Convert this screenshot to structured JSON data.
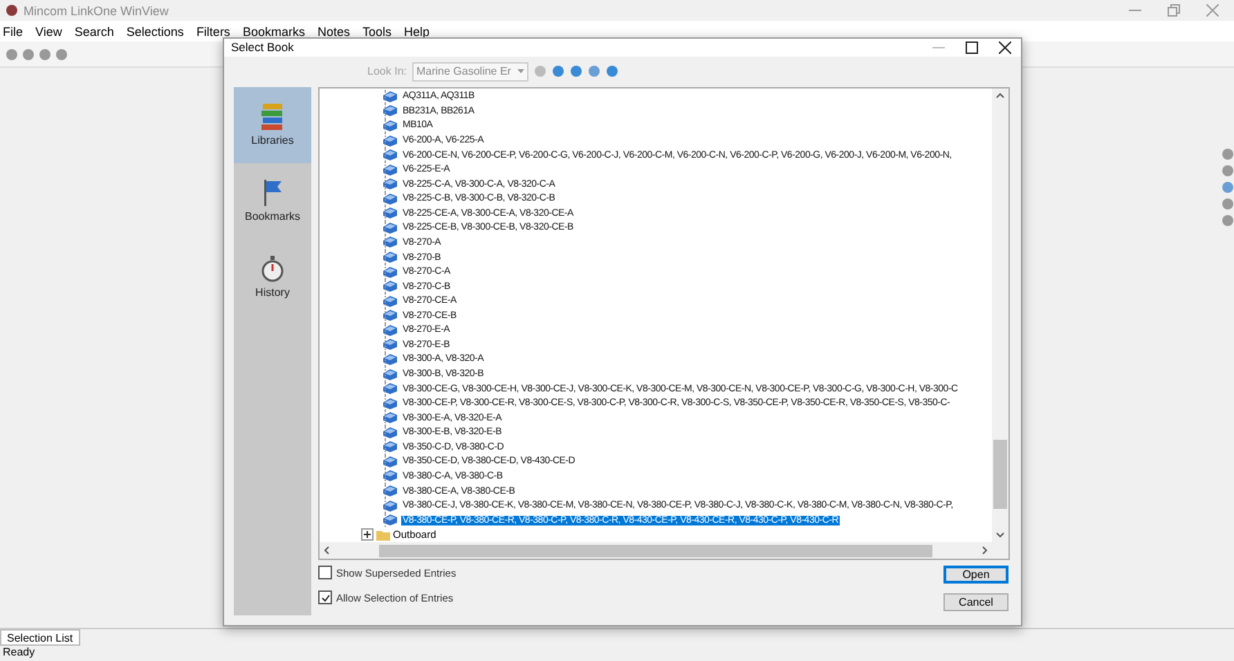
{
  "window": {
    "title": "Mincom LinkOne WinView"
  },
  "menu": [
    "File",
    "View",
    "Search",
    "Selections",
    "Filters",
    "Bookmarks",
    "Notes",
    "Tools",
    "Help"
  ],
  "dialog": {
    "title": "Select Book",
    "look_in": {
      "label": "Look In:",
      "value": "Marine Gasoline Er",
      "disabled": true
    },
    "sidebar": [
      {
        "label": "Libraries",
        "kind": "libraries",
        "selected": true
      },
      {
        "label": "Bookmarks",
        "kind": "bookmarks",
        "selected": false
      },
      {
        "label": "History",
        "kind": "history",
        "selected": false
      }
    ],
    "tree": {
      "items": [
        {
          "label": "AQ311A, AQ311B",
          "selected": false
        },
        {
          "label": "BB231A, BB261A",
          "selected": false
        },
        {
          "label": "MB10A",
          "selected": false
        },
        {
          "label": "V6-200-A, V6-225-A",
          "selected": false
        },
        {
          "label": "V6-200-CE-N, V6-200-CE-P, V6-200-C-G, V6-200-C-J, V6-200-C-M, V6-200-C-N, V6-200-C-P, V6-200-G, V6-200-J, V6-200-M, V6-200-N,",
          "selected": false
        },
        {
          "label": "V6-225-E-A",
          "selected": false
        },
        {
          "label": "V8-225-C-A, V8-300-C-A, V8-320-C-A",
          "selected": false
        },
        {
          "label": "V8-225-C-B, V8-300-C-B, V8-320-C-B",
          "selected": false
        },
        {
          "label": "V8-225-CE-A, V8-300-CE-A, V8-320-CE-A",
          "selected": false
        },
        {
          "label": "V8-225-CE-B, V8-300-CE-B, V8-320-CE-B",
          "selected": false
        },
        {
          "label": "V8-270-A",
          "selected": false
        },
        {
          "label": "V8-270-B",
          "selected": false
        },
        {
          "label": "V8-270-C-A",
          "selected": false
        },
        {
          "label": "V8-270-C-B",
          "selected": false
        },
        {
          "label": "V8-270-CE-A",
          "selected": false
        },
        {
          "label": "V8-270-CE-B",
          "selected": false
        },
        {
          "label": "V8-270-E-A",
          "selected": false
        },
        {
          "label": "V8-270-E-B",
          "selected": false
        },
        {
          "label": "V8-300-A, V8-320-A",
          "selected": false
        },
        {
          "label": "V8-300-B, V8-320-B",
          "selected": false
        },
        {
          "label": "V8-300-CE-G, V8-300-CE-H, V8-300-CE-J, V8-300-CE-K, V8-300-CE-M, V8-300-CE-N, V8-300-CE-P, V8-300-C-G, V8-300-C-H, V8-300-C",
          "selected": false
        },
        {
          "label": "V8-300-CE-P, V8-300-CE-R, V8-300-CE-S, V8-300-C-P, V8-300-C-R, V8-300-C-S, V8-350-CE-P, V8-350-CE-R, V8-350-CE-S, V8-350-C-",
          "selected": false
        },
        {
          "label": "V8-300-E-A, V8-320-E-A",
          "selected": false
        },
        {
          "label": "V8-300-E-B, V8-320-E-B",
          "selected": false
        },
        {
          "label": "V8-350-C-D, V8-380-C-D",
          "selected": false
        },
        {
          "label": "V8-350-CE-D, V8-380-CE-D, V8-430-CE-D",
          "selected": false
        },
        {
          "label": "V8-380-C-A, V8-380-C-B",
          "selected": false
        },
        {
          "label": "V8-380-CE-A, V8-380-CE-B",
          "selected": false
        },
        {
          "label": "V8-380-CE-J, V8-380-CE-K, V8-380-CE-M, V8-380-CE-N, V8-380-CE-P, V8-380-C-J, V8-380-C-K, V8-380-C-M, V8-380-C-N, V8-380-C-P,",
          "selected": false
        },
        {
          "label": "V8-380-CE-P, V8-380-CE-R, V8-380-C-P, V8-380-C-R, V8-430-CE-P, V8-430-CE-R, V8-430-C-P, V8-430-C-R",
          "selected": true
        }
      ],
      "folders": [
        {
          "label": "Outboard",
          "expanded": false
        }
      ]
    },
    "options": [
      {
        "label": "Show Superseded Entries",
        "checked": false
      },
      {
        "label": "Allow Selection of Entries",
        "checked": true
      }
    ],
    "buttons": [
      {
        "label": "Open",
        "default": true
      },
      {
        "label": "Cancel",
        "default": false
      }
    ]
  },
  "bottom_tab": "Selection List",
  "status_bar": "Ready"
}
